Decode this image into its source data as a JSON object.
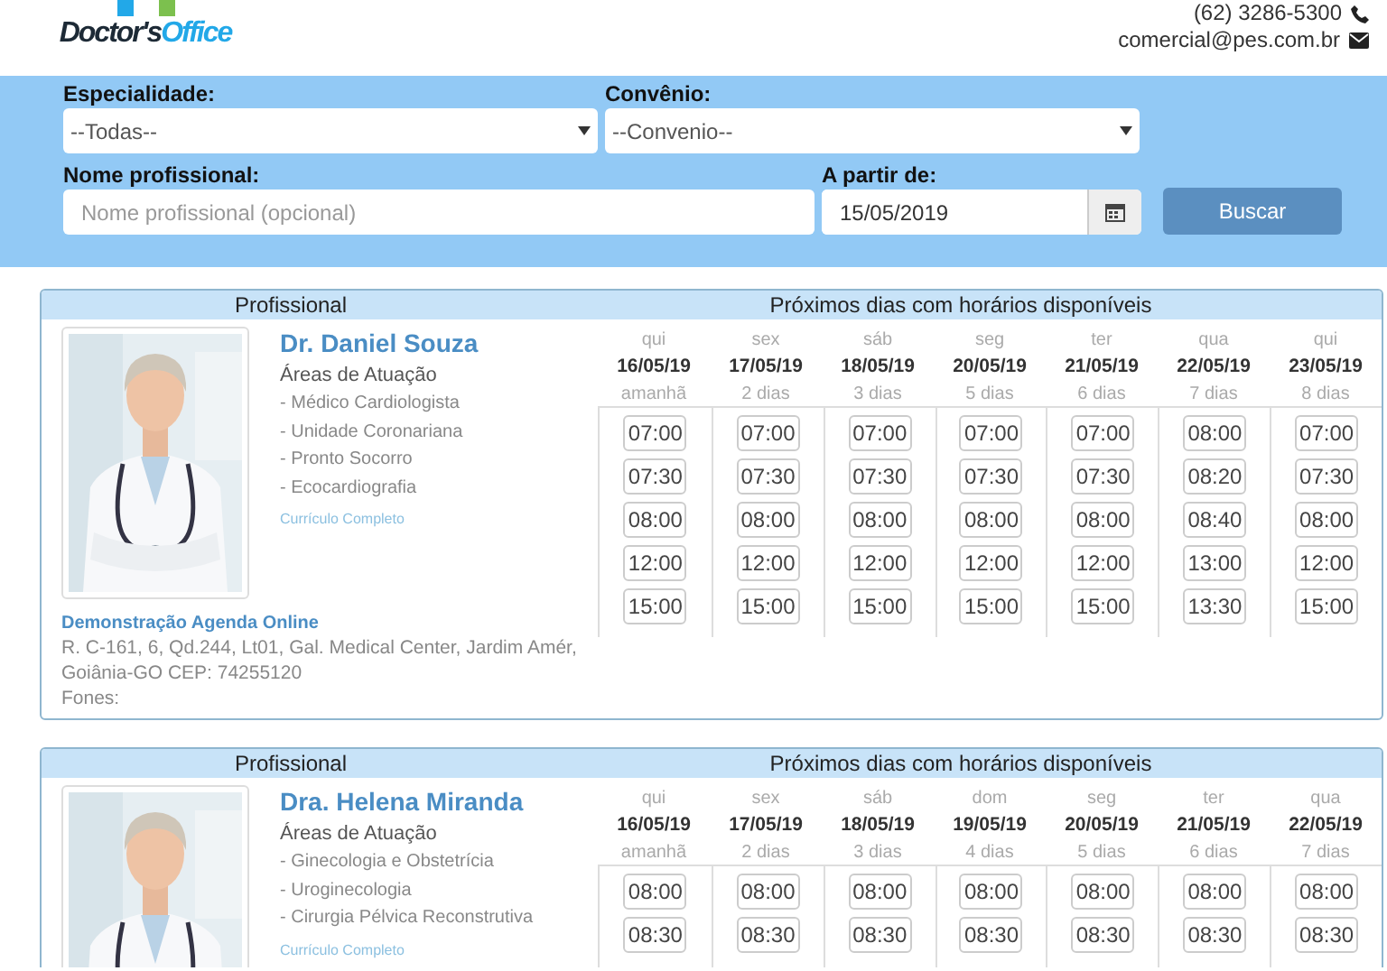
{
  "header": {
    "logo": {
      "dark": "Doctor's",
      "blue": "Office"
    },
    "phone": "(62) 3286-5300",
    "email": "comercial@pes.com.br"
  },
  "filters": {
    "specialty": {
      "label": "Especialidade:",
      "value": "--Todas--"
    },
    "insurance": {
      "label": "Convênio:",
      "value": "--Convenio--"
    },
    "name": {
      "label": "Nome profissional:",
      "placeholder": "Nome profissional (opcional)"
    },
    "date": {
      "label": "A partir de:",
      "value": "15/05/2019"
    },
    "search_button": "Buscar"
  },
  "results": [
    {
      "col_left": "Profissional",
      "col_right": "Próximos dias com horários disponíveis",
      "photo": {
        "kind": "picture"
      },
      "name": "Dr. Daniel Souza",
      "areas_title": "Áreas de Atuação",
      "areas": [
        "- Médico Cardiologista",
        "- Unidade Coronariana",
        "- Pronto Socorro",
        "- Ecocardiografia"
      ],
      "curriculum": "Currículo Completo",
      "clinic": "Demonstração Agenda Online",
      "address": "R. C-161, 6, Qd.244, Lt01, Gal. Medical Center, Jardim Amér, Goiânia-GO CEP: 74255120",
      "phones": "Fones:",
      "days": [
        {
          "weekday": "qui",
          "date": "16/05/19",
          "relative": "amanhã",
          "times": [
            "07:00",
            "07:30",
            "08:00",
            "12:00",
            "15:00"
          ]
        },
        {
          "weekday": "sex",
          "date": "17/05/19",
          "relative": "2 dias",
          "times": [
            "07:00",
            "07:30",
            "08:00",
            "12:00",
            "15:00"
          ]
        },
        {
          "weekday": "sáb",
          "date": "18/05/19",
          "relative": "3 dias",
          "times": [
            "07:00",
            "07:30",
            "08:00",
            "12:00",
            "15:00"
          ]
        },
        {
          "weekday": "seg",
          "date": "20/05/19",
          "relative": "5 dias",
          "times": [
            "07:00",
            "07:30",
            "08:00",
            "12:00",
            "15:00"
          ]
        },
        {
          "weekday": "ter",
          "date": "21/05/19",
          "relative": "6 dias",
          "times": [
            "07:00",
            "07:30",
            "08:00",
            "12:00",
            "15:00"
          ]
        },
        {
          "weekday": "qua",
          "date": "22/05/19",
          "relative": "7 dias",
          "times": [
            "08:00",
            "08:20",
            "08:40",
            "13:00",
            "13:30"
          ]
        },
        {
          "weekday": "qui",
          "date": "23/05/19",
          "relative": "8 dias",
          "times": [
            "07:00",
            "07:30",
            "08:00",
            "12:00",
            "15:00"
          ]
        }
      ]
    },
    {
      "col_left": "Profissional",
      "col_right": "Próximos dias com horários disponíveis",
      "photo": {
        "kind": "picture"
      },
      "name": "Dra. Helena Miranda",
      "areas_title": "Áreas de Atuação",
      "areas": [
        "- Ginecologia e Obstetrícia",
        "- Uroginecologia",
        "- Cirurgia Pélvica Reconstrutiva"
      ],
      "curriculum": "Currículo Completo",
      "days": [
        {
          "weekday": "qui",
          "date": "16/05/19",
          "relative": "amanhã",
          "times": [
            "08:00",
            "08:30"
          ]
        },
        {
          "weekday": "sex",
          "date": "17/05/19",
          "relative": "2 dias",
          "times": [
            "08:00",
            "08:30"
          ]
        },
        {
          "weekday": "sáb",
          "date": "18/05/19",
          "relative": "3 dias",
          "times": [
            "08:00",
            "08:30"
          ]
        },
        {
          "weekday": "dom",
          "date": "19/05/19",
          "relative": "4 dias",
          "times": [
            "08:00",
            "08:30"
          ]
        },
        {
          "weekday": "seg",
          "date": "20/05/19",
          "relative": "5 dias",
          "times": [
            "08:00",
            "08:30"
          ]
        },
        {
          "weekday": "ter",
          "date": "21/05/19",
          "relative": "6 dias",
          "times": [
            "08:00",
            "08:30"
          ]
        },
        {
          "weekday": "qua",
          "date": "22/05/19",
          "relative": "7 dias",
          "times": [
            "08:00",
            "08:30"
          ]
        }
      ]
    }
  ]
}
